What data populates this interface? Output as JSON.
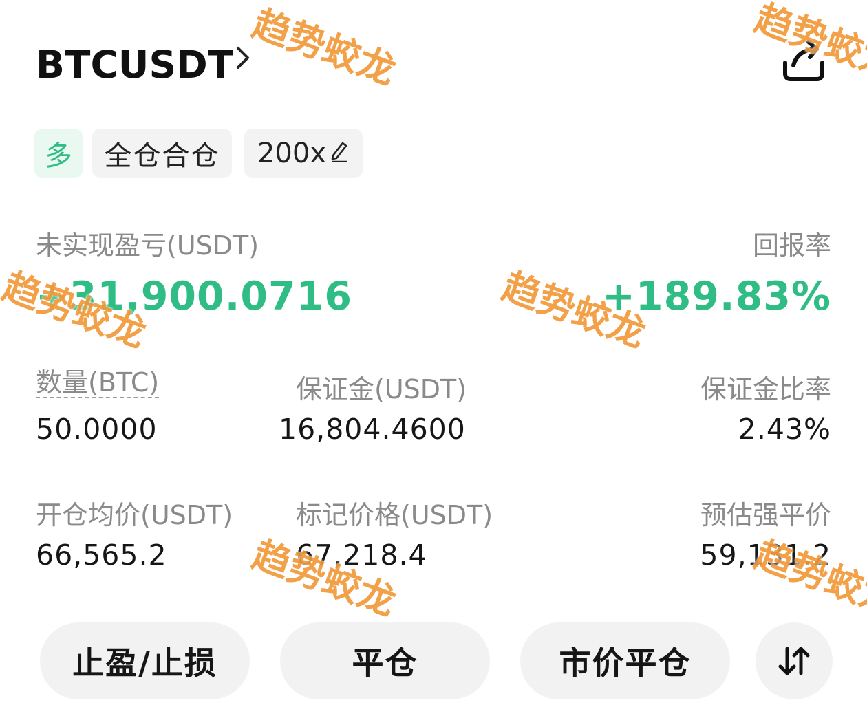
{
  "header": {
    "symbol": "BTCUSDT",
    "chevron_icon": "chevron-right-icon",
    "share_icon": "share-icon"
  },
  "tags": {
    "side": "多",
    "margin_mode": "全仓合仓",
    "leverage": "200x",
    "edit_icon": "pencil-icon"
  },
  "pnl": {
    "unrealized_label": "未实现盈亏(USDT)",
    "unrealized_value": "+31,900.0716",
    "roe_label": "回报率",
    "roe_value": "+189.83%"
  },
  "stats": {
    "quantity_label": "数量(BTC)",
    "quantity_value": "50.0000",
    "margin_label": "保证金(USDT)",
    "margin_value": "16,804.4600",
    "margin_ratio_label": "保证金比率",
    "margin_ratio_value": "2.43%",
    "entry_price_label": "开仓均价(USDT)",
    "entry_price_value": "66,565.2",
    "mark_price_label": "标记价格(USDT)",
    "mark_price_value": "67,218.4",
    "liq_price_label": "预估强平价",
    "liq_price_value": "59,131.2"
  },
  "actions": {
    "tpsl": "止盈/止损",
    "close": "平仓",
    "market_close": "市价平仓",
    "reverse_icon": "swap-vertical-icon"
  },
  "watermark": "趋势蛟龙",
  "colors": {
    "profit_green": "#2fbd85",
    "watermark_orange": "#f39a3a",
    "chip_bg": "#f3f3f3",
    "long_tag_bg": "#eaf8f2"
  }
}
